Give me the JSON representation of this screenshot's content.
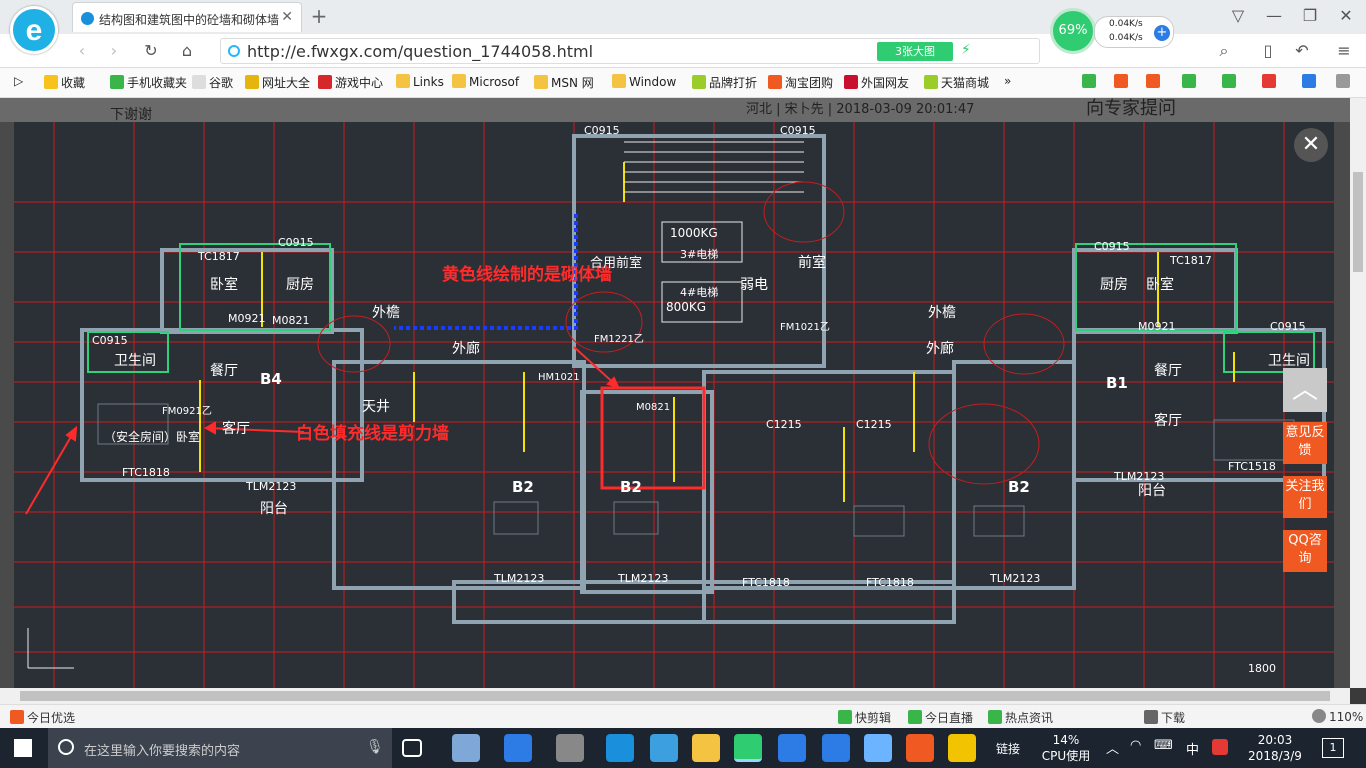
{
  "browser": {
    "tab_title": "结构图和建筑图中的砼墙和砌体墙",
    "url": "http://e.fwxgx.com/question_1744058.html",
    "image_count_btn": "3张大图",
    "perf_percent": "69%",
    "up_speed": "0.04K/s",
    "down_speed": "0.04K/s"
  },
  "favorites": [
    "收藏",
    "手机收藏夹",
    "谷歌",
    "网址大全",
    "游戏中心",
    "Links",
    "Microsof",
    "MSN 网",
    "Window",
    "品牌打折",
    "淘宝团购",
    "外国网友",
    "天猫商城"
  ],
  "page": {
    "heading_partial": "下谢谢",
    "meta": "河北 | 宋卜先 | 2018-03-09 20:01:47",
    "ask_expert": "向专家提问"
  },
  "annotations": {
    "yellow_note": "黄色线绘制的是砌体墙",
    "white_note": "白色填充线是剪力墙"
  },
  "plan_labels": {
    "units": [
      "B4",
      "B2",
      "B2",
      "B2",
      "B1"
    ],
    "rooms": [
      "卧室",
      "厨房",
      "外檐",
      "外廊",
      "卫生间",
      "餐厅",
      "客厅",
      "（安全房间）卧室",
      "阳台",
      "天井",
      "合用前室",
      "前室",
      "弱电",
      "外檐",
      "外廊",
      "厨房",
      "卧室",
      "卫生间",
      "餐厅",
      "客厅",
      "阳台"
    ],
    "codes": [
      "C0915",
      "C0915",
      "TC1817",
      "C0915",
      "M0921",
      "M0821",
      "C0915",
      "FM0921乙",
      "FTC1818",
      "TLM2123",
      "FM1221乙",
      "FM1021乙",
      "HM1021",
      "M0821",
      "C1215",
      "C1215",
      "TLM2123",
      "FTC1818",
      "TLM2123",
      "FTC1818",
      "TLM2123",
      "C0915",
      "TC1817",
      "C0915",
      "M0921",
      "FTC1518",
      "TLM2123"
    ],
    "elevator_1": "1000KG",
    "elevator_2": "800KG",
    "elevator_1_no": "3#电梯",
    "elevator_2_no": "4#电梯",
    "dim_1800": "1800"
  },
  "side_buttons": [
    "意见反馈",
    "关注我们",
    "QQ咨询"
  ],
  "statusbar": {
    "left": "今日优选",
    "items": [
      "快剪辑",
      "今日直播",
      "热点资讯",
      "下载"
    ],
    "zoom": "110%"
  },
  "taskbar": {
    "search_placeholder": "在这里输入你要搜索的内容",
    "link_label": "链接",
    "cpu_percent": "14%",
    "cpu_label": "CPU使用",
    "ime": "中",
    "time": "20:03",
    "date": "2018/3/9",
    "notif_count": "1"
  },
  "colors": {
    "cad_bg": "#2b2f36",
    "accent_red": "#ff2b2b",
    "yellow": "#f2e300",
    "orange": "#f05a22",
    "green": "#2fcc71"
  }
}
